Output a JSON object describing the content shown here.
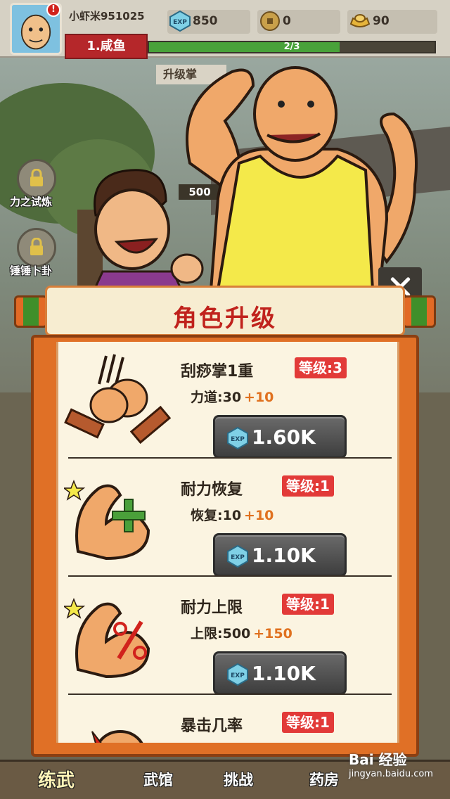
{
  "player": {
    "name": "小虾米951025",
    "alert_badge": "!",
    "rank": "1.咸鱼",
    "progress_text": "2/3",
    "progress_fraction": 0.667
  },
  "resources": {
    "exp": "850",
    "coin": "0",
    "gold": "90"
  },
  "side_menu": [
    "力之试炼",
    "锤锤卜卦"
  ],
  "background_labels": {
    "task_banner": "升级掌",
    "reward_value": "500"
  },
  "dialog": {
    "title": "角色升级",
    "skills": [
      {
        "name": "刮痧掌1重",
        "level": "等级:3",
        "stat": "力道:30",
        "bonus": "+10",
        "cost": "1.60K",
        "icon": "fist-smash-icon"
      },
      {
        "name": "耐力恢复",
        "level": "等级:1",
        "stat": "恢复:10",
        "bonus": "+10",
        "cost": "1.10K",
        "icon": "muscle-plus-icon"
      },
      {
        "name": "耐力上限",
        "level": "等级:1",
        "stat": "上限:500",
        "bonus": "+150",
        "cost": "1.10K",
        "icon": "muscle-percent-icon"
      },
      {
        "name": "暴击几率",
        "level": "等级:1",
        "stat": "",
        "bonus": "",
        "cost": "",
        "icon": "crit-icon"
      }
    ]
  },
  "tabs": [
    "练武",
    "武馆",
    "挑战",
    "药房"
  ],
  "watermark": {
    "line1": "Bai 经验",
    "line2": "jingyan.baidu.com"
  },
  "colors": {
    "level_badge": "#e23a38",
    "dialog_title": "#c0221c",
    "bonus": "#e0711f",
    "frame": "#e07026"
  }
}
